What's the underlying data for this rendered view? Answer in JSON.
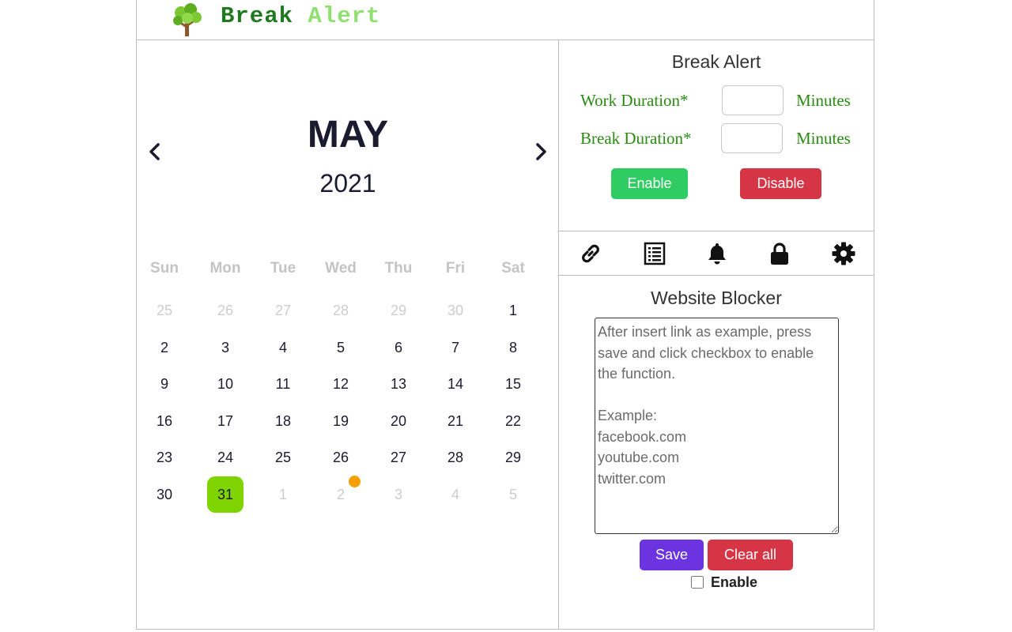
{
  "header": {
    "brand_word1": "Break",
    "brand_word2": "Alert"
  },
  "calendar": {
    "month": "MAY",
    "year": "2021",
    "weekdays": [
      "Sun",
      "Mon",
      "Tue",
      "Wed",
      "Thu",
      "Fri",
      "Sat"
    ],
    "weeks": [
      [
        {
          "d": "25",
          "muted": true
        },
        {
          "d": "26",
          "muted": true
        },
        {
          "d": "27",
          "muted": true
        },
        {
          "d": "28",
          "muted": true
        },
        {
          "d": "29",
          "muted": true
        },
        {
          "d": "30",
          "muted": true
        },
        {
          "d": "1"
        }
      ],
      [
        {
          "d": "2"
        },
        {
          "d": "3"
        },
        {
          "d": "4"
        },
        {
          "d": "5"
        },
        {
          "d": "6"
        },
        {
          "d": "7"
        },
        {
          "d": "8"
        }
      ],
      [
        {
          "d": "9"
        },
        {
          "d": "10"
        },
        {
          "d": "11"
        },
        {
          "d": "12"
        },
        {
          "d": "13"
        },
        {
          "d": "14"
        },
        {
          "d": "15"
        }
      ],
      [
        {
          "d": "16"
        },
        {
          "d": "17"
        },
        {
          "d": "18"
        },
        {
          "d": "19"
        },
        {
          "d": "20"
        },
        {
          "d": "21"
        },
        {
          "d": "22"
        }
      ],
      [
        {
          "d": "23"
        },
        {
          "d": "24"
        },
        {
          "d": "25"
        },
        {
          "d": "26"
        },
        {
          "d": "27"
        },
        {
          "d": "28"
        },
        {
          "d": "29"
        }
      ],
      [
        {
          "d": "30"
        },
        {
          "d": "31",
          "today": true
        },
        {
          "d": "1",
          "muted": true
        },
        {
          "d": "2",
          "muted": true,
          "event": true
        },
        {
          "d": "3",
          "muted": true
        },
        {
          "d": "4",
          "muted": true
        },
        {
          "d": "5",
          "muted": true
        }
      ]
    ]
  },
  "break_alert": {
    "title": "Break Alert",
    "work_label": "Work Duration*",
    "break_label": "Break Duration*",
    "work_unit": "Minutes",
    "break_unit": "Minutes",
    "work_value": "",
    "break_value": "",
    "enable_label": "Enable",
    "disable_label": "Disable"
  },
  "toolbar": {
    "icons": [
      "link-icon",
      "list-icon",
      "bell-icon",
      "lock-icon",
      "gear-icon"
    ]
  },
  "website_blocker": {
    "title": "Website Blocker",
    "placeholder": "After insert link as example, press save and click checkbox to enable the function.\n\nExample:\nfacebook.com\nyoutube.com\ntwitter.com",
    "save_label": "Save",
    "clear_label": "Clear all",
    "checkbox_label": "Enable"
  },
  "colors": {
    "brand_dark": "#1f7a1f",
    "brand_light": "#8fe070",
    "label_green": "#2a8a12",
    "enable": "#2ecc62",
    "danger": "#d63545",
    "save": "#6b34e0",
    "today": "#7fd400",
    "event_dot": "#f5a000"
  }
}
